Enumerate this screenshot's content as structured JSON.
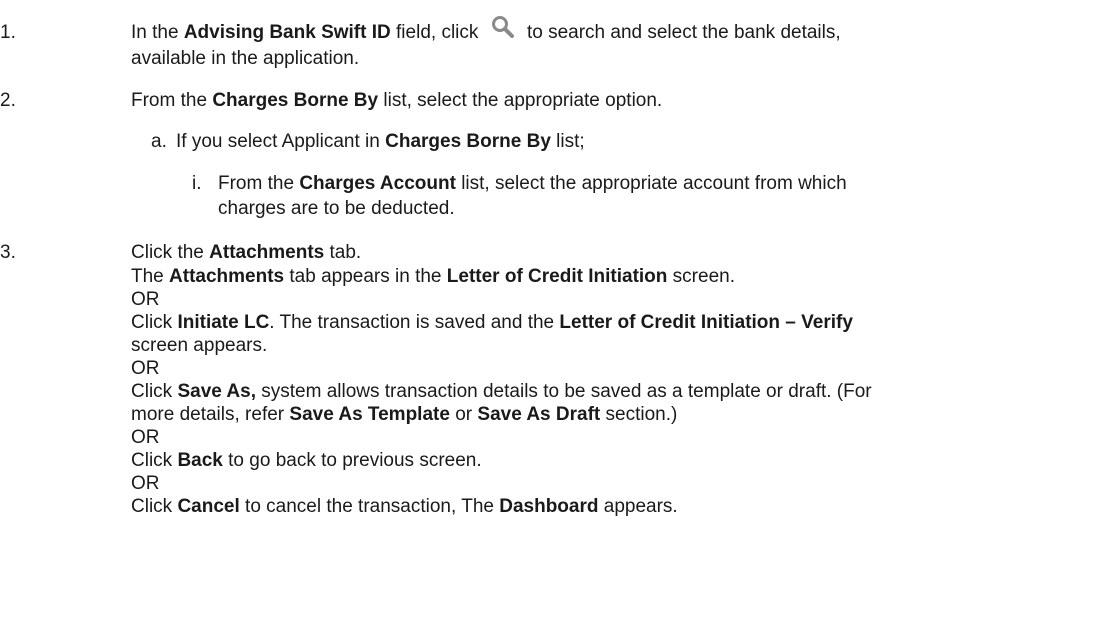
{
  "steps": [
    {
      "number": "1.",
      "parts": {
        "p1": "In the ",
        "b1": "Advising Bank Swift ID",
        "p2": " field, click ",
        "p3": " to search and select the bank details,",
        "cont": "available in the application."
      }
    },
    {
      "number": "2.",
      "parts": {
        "p1": "From the ",
        "b1": "Charges Borne By",
        "p2": " list, select the appropriate option."
      },
      "sub": {
        "letter": "a.",
        "p1": "If you select Applicant in ",
        "b1": "Charges Borne By",
        "p2": " list;",
        "subsub": {
          "roman": "i.",
          "p1": "From the ",
          "b1": "Charges Account",
          "p2": " list, select the appropriate account from which",
          "cont": "charges are to be deducted."
        }
      }
    },
    {
      "number": "3.",
      "parts": {
        "p1": "Click the ",
        "b1": "Attachments",
        "p2": " tab.",
        "l2_b1": "The ",
        "l2_b2": "Attachments",
        "l2_p2": " tab appears in the ",
        "l2_b3": "Letter of Credit Initiation",
        "l2_p3": " screen.",
        "or1": " OR",
        "l4_p1": "Click ",
        "l4_b1": "Initiate LC",
        "l4_p2": ". The transaction is saved and the ",
        "l4_b2": "Letter of Credit Initiation – Verify",
        "l5": "screen appears.",
        "or2": "OR",
        "l7_p1": "Click ",
        "l7_b1": "Save As,",
        "l7_p2": " system allows transaction details to be saved as a template or draft. (For",
        "l8_p1": "more details, refer ",
        "l8_b1": "Save As Template",
        "l8_p2": " or ",
        "l8_b2": "Save As Draft",
        "l8_p3": " section.)",
        "or3": "OR",
        "l10_p1": "Click ",
        "l10_b1": "Back",
        "l10_p2": " to go back to previous screen.",
        "or4": "OR",
        "l12_p1": "Click ",
        "l12_b1": "Cancel",
        "l12_p2": " to cancel the transaction, The ",
        "l12_b2": "Dashboard",
        "l12_p3": " appears."
      }
    }
  ],
  "icons": {
    "search": "search-icon",
    "search_color": "#888888"
  }
}
